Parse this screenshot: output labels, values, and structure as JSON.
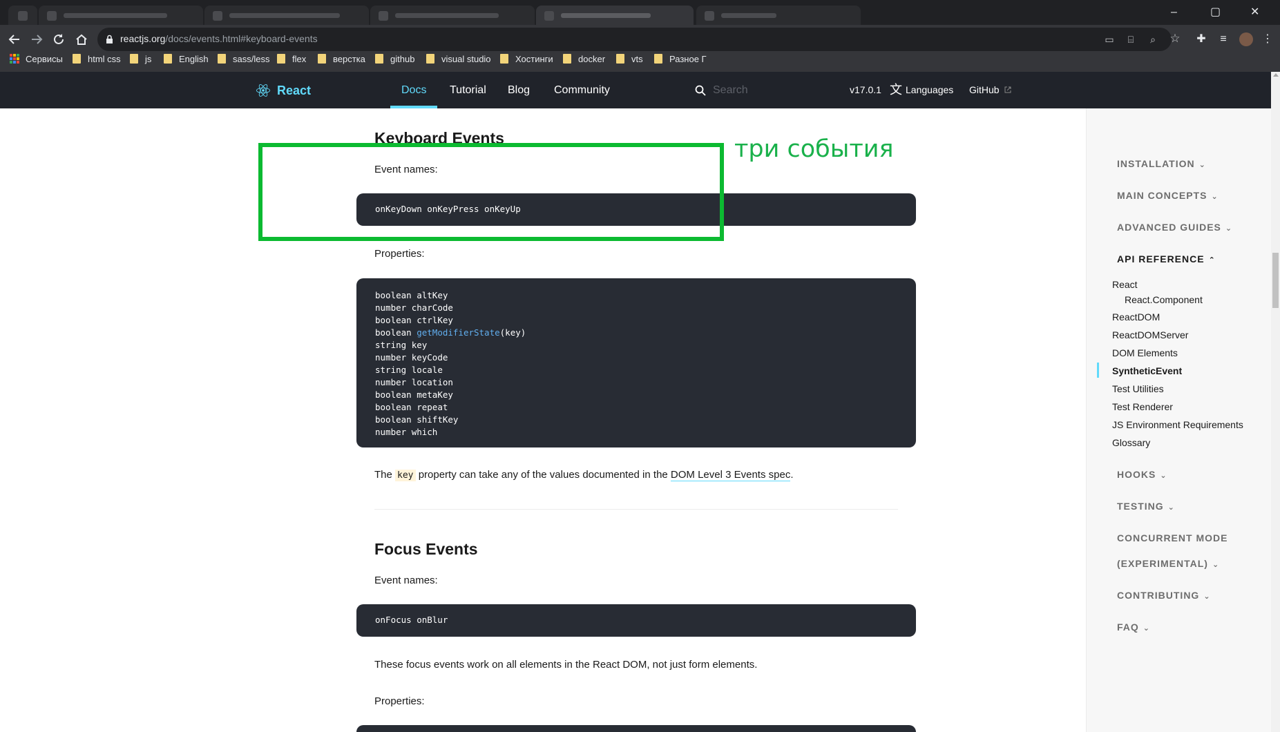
{
  "browser": {
    "url_host": "reactjs.org",
    "url_path": "/docs/events.html#keyboard-events",
    "bookmarks": [
      "Сервисы",
      "html css",
      "js",
      "English",
      "sass/less",
      "flex",
      "верстка",
      "github",
      "visual studio",
      "Хостинги",
      "docker",
      "vts",
      "Разное Г"
    ]
  },
  "header": {
    "brand": "React",
    "nav": [
      "Docs",
      "Tutorial",
      "Blog",
      "Community"
    ],
    "active_nav": "Docs",
    "search_placeholder": "Search",
    "version": "v17.0.1",
    "languages": "Languages",
    "github": "GitHub"
  },
  "content": {
    "keyboard": {
      "title": "Keyboard Events",
      "event_names_label": "Event names:",
      "event_names_code": "onKeyDown onKeyPress onKeyUp",
      "properties_label": "Properties:",
      "properties": [
        [
          "boolean ",
          "altKey",
          ""
        ],
        [
          "number ",
          "charCode",
          ""
        ],
        [
          "boolean ",
          "ctrlKey",
          ""
        ],
        [
          "boolean ",
          "getModifierState",
          "(key)"
        ],
        [
          "string ",
          "key",
          ""
        ],
        [
          "number ",
          "keyCode",
          ""
        ],
        [
          "string ",
          "locale",
          ""
        ],
        [
          "number ",
          "location",
          ""
        ],
        [
          "boolean ",
          "metaKey",
          ""
        ],
        [
          "boolean ",
          "repeat",
          ""
        ],
        [
          "boolean ",
          "shiftKey",
          ""
        ],
        [
          "number ",
          "which",
          ""
        ]
      ],
      "note_prefix": "The",
      "note_code": "key",
      "note_middle": "property can take any of the values documented in the",
      "note_link": "DOM Level 3 Events spec",
      "note_suffix": "."
    },
    "focus": {
      "title": "Focus Events",
      "event_names_label": "Event names:",
      "event_names_code": "onFocus onBlur",
      "description": "These focus events work on all elements in the React DOM, not just form elements.",
      "properties_label": "Properties:"
    },
    "annotation": {
      "text": "три события",
      "color": "#0cba31"
    }
  },
  "sidebar": {
    "sections": [
      "INSTALLATION",
      "MAIN CONCEPTS",
      "ADVANCED GUIDES",
      "API REFERENCE",
      "HOOKS",
      "TESTING",
      "CONCURRENT MODE",
      "(EXPERIMENTAL)",
      "CONTRIBUTING",
      "FAQ"
    ],
    "api_items": [
      "React",
      "React.Component",
      "ReactDOM",
      "ReactDOMServer",
      "DOM Elements",
      "SyntheticEvent",
      "Test Utilities",
      "Test Renderer",
      "JS Environment Requirements",
      "Glossary"
    ],
    "current_item": "SyntheticEvent"
  },
  "colors": {
    "header_bg": "#20232a",
    "accent": "#61dafb",
    "code_bg": "#282c34"
  }
}
